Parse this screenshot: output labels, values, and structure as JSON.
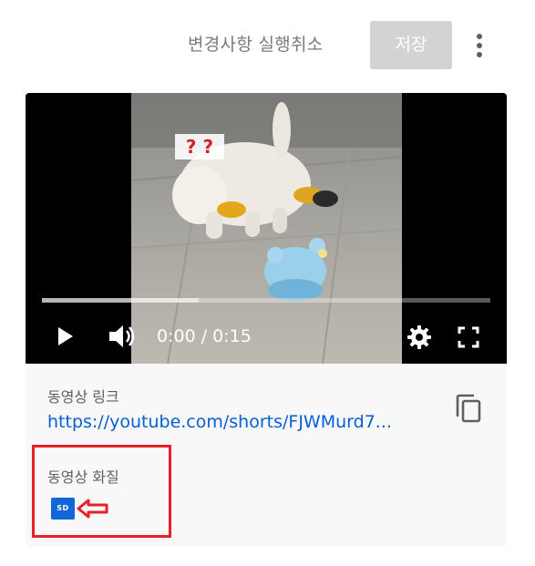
{
  "toolbar": {
    "undo_label": "변경사항 실행취소",
    "save_label": "저장",
    "more_icon": "more-vert-icon"
  },
  "player": {
    "frame_overlay_text": "? ?",
    "time_display": "0:00 / 0:15",
    "progress_fraction": 0.0,
    "buffered_fraction": 0.35,
    "icons": [
      "play-icon",
      "volume-icon",
      "settings-gear-icon",
      "fullscreen-icon"
    ]
  },
  "details": {
    "link_label": "동영상 링크",
    "link_url": "https://youtube.com/shorts/FJWMurd7...",
    "quality_label": "동영상 화질",
    "quality_badge": "SD",
    "copy_icon": "copy-icon"
  },
  "annotation": {
    "color": "#e8202a"
  },
  "colors": {
    "link": "#065fd4",
    "badge": "#1366d6",
    "save_disabled": "#d3d3d3"
  }
}
